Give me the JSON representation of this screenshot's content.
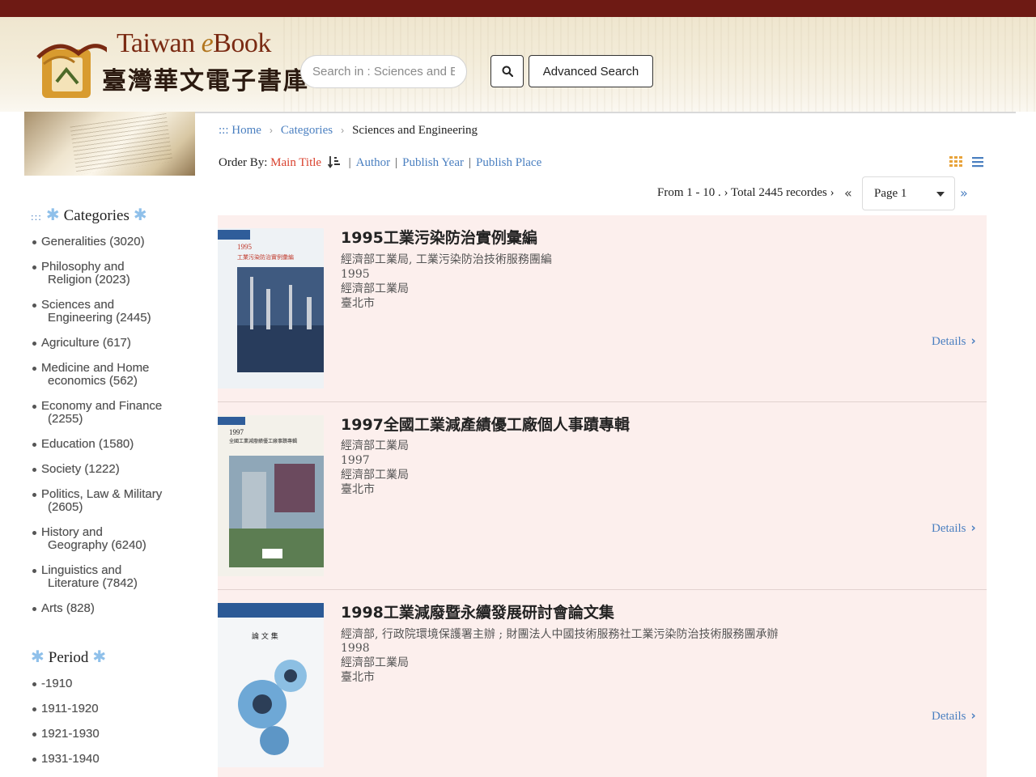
{
  "header": {
    "logo_en_prefix": "Taiwan ",
    "logo_en_e": "e",
    "logo_en_suffix": "Book",
    "logo_zh": "臺灣華文電子書庫",
    "search_placeholder": "Search in : Sciences and Eng",
    "search_icon": "search-icon",
    "advanced_search_label": "Advanced Search"
  },
  "sidebar": {
    "categories_dots": ":::",
    "categories_title": "Categories",
    "categories": [
      {
        "line1": "Generalities (3020)",
        "line2": ""
      },
      {
        "line1": "Philosophy and",
        "line2": "Religion (2023)"
      },
      {
        "line1": "Sciences and",
        "line2": "Engineering (2445)"
      },
      {
        "line1": "Agriculture (617)",
        "line2": ""
      },
      {
        "line1": "Medicine and Home",
        "line2": "economics (562)"
      },
      {
        "line1": "Economy and Finance",
        "line2": "(2255)"
      },
      {
        "line1": "Education (1580)",
        "line2": ""
      },
      {
        "line1": "Society (1222)",
        "line2": ""
      },
      {
        "line1": "Politics, Law & Military",
        "line2": "(2605)"
      },
      {
        "line1": "History and",
        "line2": "Geography (6240)"
      },
      {
        "line1": "Linguistics and",
        "line2": "Literature (7842)"
      },
      {
        "line1": "Arts (828)",
        "line2": ""
      }
    ],
    "period_title": "Period",
    "periods": [
      "-1910",
      "1911-1920",
      "1921-1930",
      "1931-1940"
    ]
  },
  "breadcrumb": {
    "home": "::: Home",
    "categories": "Categories",
    "current": "Sciences and Engineering"
  },
  "order_by": {
    "label": "Order By:",
    "main_title": "Main Title",
    "author": "Author",
    "publish_year": "Publish Year",
    "publish_place": "Publish Place"
  },
  "pager": {
    "range_prefix": "From ",
    "range_bold": "1 - 10",
    "range_suffix": " . ›  Total 2445 recordes ›",
    "page_label": "Page 1",
    "first": "«",
    "last": "»"
  },
  "books": [
    {
      "title": "1995工業污染防治實例彙編",
      "author": "經濟部工業局, 工業污染防治技術服務團編",
      "year": "1995",
      "publisher": "經濟部工業局",
      "place": "臺北市",
      "details_label": "Details",
      "cover_year": "1995",
      "cover_title": "工業污染防治實例彙編"
    },
    {
      "title": "1997全國工業減產績優工廠個人事蹟專輯",
      "author": "經濟部工業局",
      "year": "1997",
      "publisher": "經濟部工業局",
      "place": "臺北市",
      "details_label": "Details",
      "cover_year": "1997",
      "cover_title": "全國工業減廢績優工廠事蹟專輯"
    },
    {
      "title": "1998工業減廢暨永續發展研討會論文集",
      "author": "經濟部, 行政院環境保護署主辦 ; 財團法人中國技術服務社工業污染防治技術服務團承辦",
      "year": "1998",
      "publisher": "經濟部工業局",
      "place": "臺北市",
      "details_label": "Details",
      "cover_year": "",
      "cover_title": "論 文 集"
    }
  ]
}
